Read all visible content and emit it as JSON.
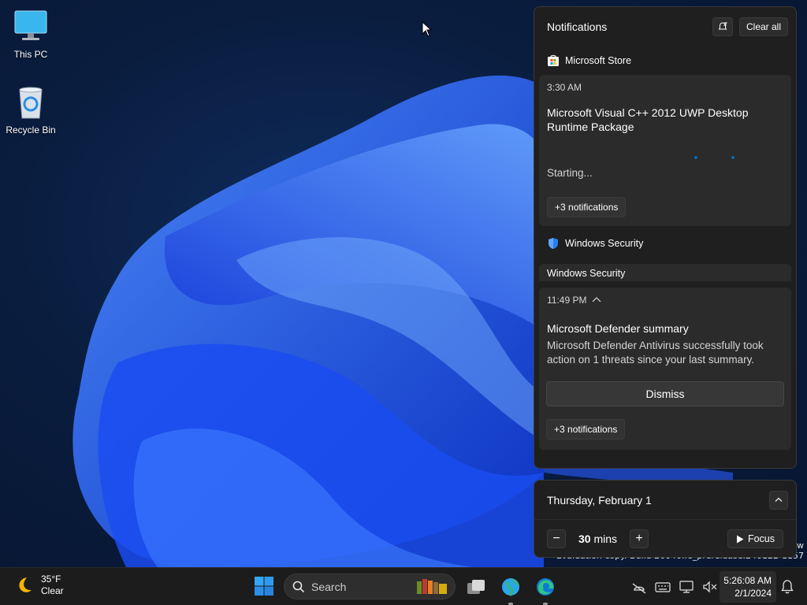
{
  "desktop": {
    "icons": [
      {
        "label": "This PC",
        "icon": "monitor-icon"
      },
      {
        "label": "Recycle Bin",
        "icon": "recycle-bin-icon"
      }
    ],
    "watermark": "Evaluation copy. Build 26040.rs_prerelease.240122-1157",
    "watermark_fragment": "w"
  },
  "notifications": {
    "title": "Notifications",
    "dnd_icon": "do-not-disturb-icon",
    "clear_all_label": "Clear all",
    "groups": [
      {
        "app": "Microsoft Store",
        "icon": "microsoft-store-icon",
        "toast": {
          "time": "3:30 AM",
          "title": "Microsoft Visual C++ 2012 UWP Desktop Runtime Package",
          "status": "Starting...",
          "more": "+3 notifications"
        }
      },
      {
        "app": "Windows Security",
        "icon": "shield-icon",
        "subheader": "Windows Security",
        "toast": {
          "time": "11:49 PM",
          "title": "Microsoft Defender summary",
          "body": "Microsoft Defender Antivirus successfully took action on 1 threats since your last summary.",
          "action": "Dismiss",
          "more": "+3 notifications"
        }
      }
    ]
  },
  "calendar": {
    "date": "Thursday, February 1",
    "focus": {
      "minus": "−",
      "plus": "+",
      "minutes": "30",
      "unit": "mins",
      "button": "Focus"
    }
  },
  "taskbar": {
    "weather": {
      "temp": "35°F",
      "condition": "Clear",
      "icon": "moon-icon"
    },
    "search_label": "Search",
    "apps": [
      "start-icon",
      "task-view-icon",
      "globe-app-icon",
      "edge-icon"
    ],
    "tray": [
      "network-off-icon",
      "keyboard-icon",
      "display-icon",
      "volume-muted-icon"
    ],
    "clock": {
      "time": "5:26:08 AM",
      "date": "2/1/2024"
    }
  },
  "colors": {
    "accent": "#0078d4",
    "panel_bg": "#1f1f1f",
    "toast_bg": "#2b2b2b",
    "taskbar_bg": "#1c1c1c"
  }
}
